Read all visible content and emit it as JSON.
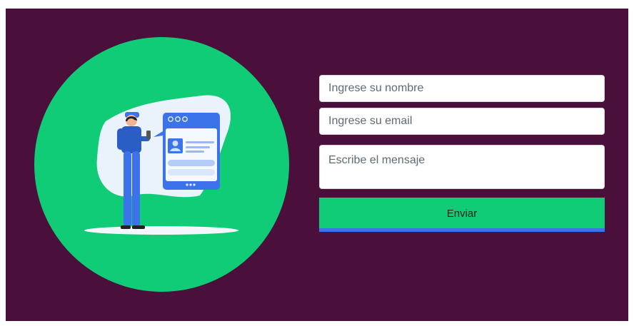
{
  "colors": {
    "panel_bg": "#4a0f3b",
    "accent": "#11cc77",
    "button_underline": "#3d73ea"
  },
  "illustration": {
    "description_icon": "person-with-phone-profile-card-icon"
  },
  "form": {
    "name_placeholder": "Ingrese su nombre",
    "email_placeholder": "Ingrese su email",
    "message_placeholder": "Escribe el mensaje",
    "submit_label": "Enviar"
  }
}
